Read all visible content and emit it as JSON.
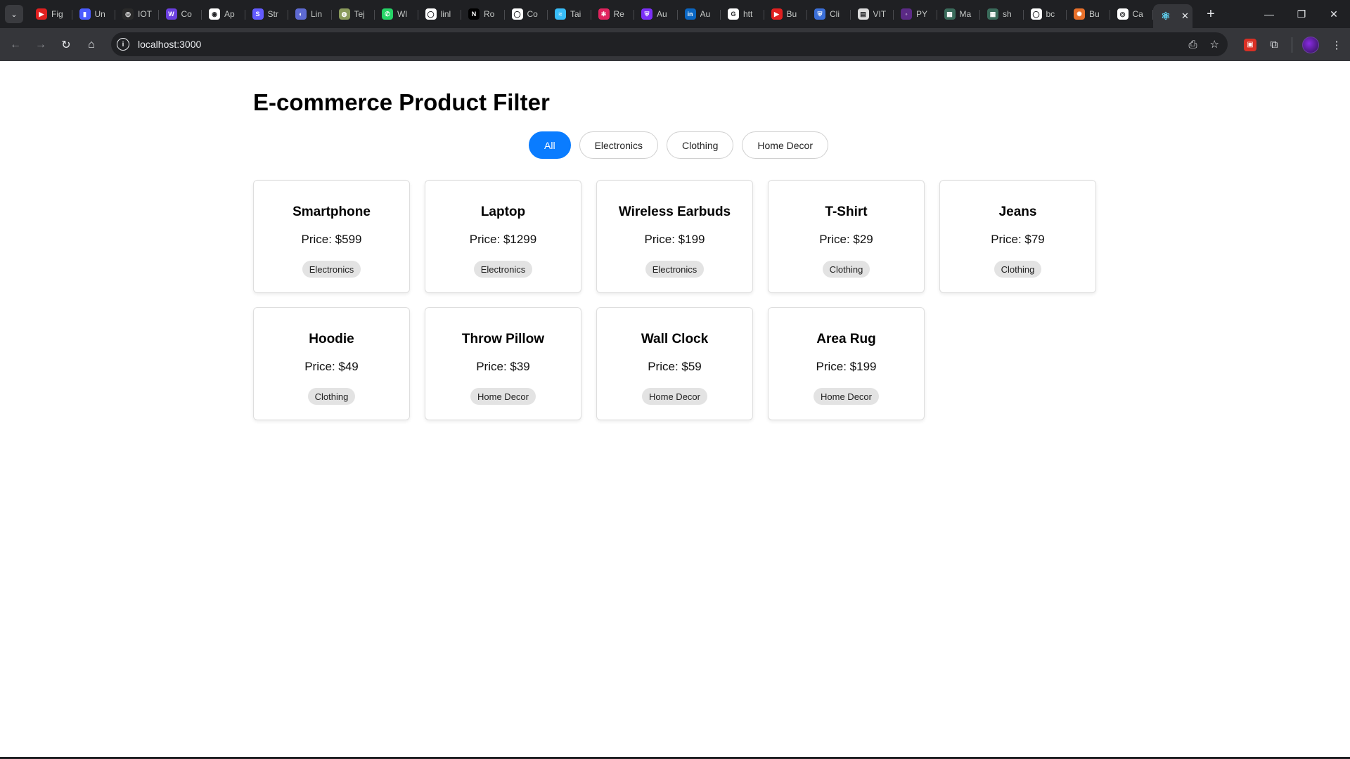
{
  "browser": {
    "tabs": [
      {
        "label": "Fig",
        "color": "#e02020",
        "glyph": "▶"
      },
      {
        "label": "Un",
        "color": "#4b5cff",
        "glyph": "▮"
      },
      {
        "label": "IOT",
        "color": "#2a2a2a",
        "glyph": "◎"
      },
      {
        "label": "Co",
        "color": "#6b3fe0",
        "glyph": "W"
      },
      {
        "label": "Ap",
        "color": "#ffffff",
        "glyph": "◉"
      },
      {
        "label": "Str",
        "color": "#635bff",
        "glyph": "S"
      },
      {
        "label": "Lin",
        "color": "#5e6ad2",
        "glyph": "◐"
      },
      {
        "label": "Tej",
        "color": "#8a9a5b",
        "glyph": "◍"
      },
      {
        "label": "Wl",
        "color": "#25d366",
        "glyph": "✆"
      },
      {
        "label": "linl",
        "color": "#ffffff",
        "glyph": "◯"
      },
      {
        "label": "Ro",
        "color": "#000000",
        "glyph": "N"
      },
      {
        "label": "Co",
        "color": "#ffffff",
        "glyph": "◯"
      },
      {
        "label": "Tai",
        "color": "#38bdf8",
        "glyph": "≈"
      },
      {
        "label": "Re",
        "color": "#e0245e",
        "glyph": "✻"
      },
      {
        "label": "Au",
        "color": "#7b2ff7",
        "glyph": "⛨"
      },
      {
        "label": "Au",
        "color": "#0a66c2",
        "glyph": "in"
      },
      {
        "label": "htt",
        "color": "#ffffff",
        "glyph": "G"
      },
      {
        "label": "Bu",
        "color": "#e02020",
        "glyph": "▶"
      },
      {
        "label": "Cli",
        "color": "#3b6fd8",
        "glyph": "⛨"
      },
      {
        "label": "VIT",
        "color": "#dddddd",
        "glyph": "▤"
      },
      {
        "label": "PY",
        "color": "#5b2a86",
        "glyph": "◦"
      },
      {
        "label": "Ma",
        "color": "#3a6b5b",
        "glyph": "▦"
      },
      {
        "label": "sh",
        "color": "#3a6b5b",
        "glyph": "▦"
      },
      {
        "label": "bc",
        "color": "#ffffff",
        "glyph": "◯"
      },
      {
        "label": "Bu",
        "color": "#e8702a",
        "glyph": "✺"
      },
      {
        "label": "Ca",
        "color": "#ffffff",
        "glyph": "◎"
      }
    ],
    "active_tab_glyph": "⚛",
    "url": "localhost:3000"
  },
  "page": {
    "title": "E-commerce Product Filter",
    "filters": [
      {
        "label": "All",
        "active": true
      },
      {
        "label": "Electronics",
        "active": false
      },
      {
        "label": "Clothing",
        "active": false
      },
      {
        "label": "Home Decor",
        "active": false
      }
    ],
    "products": [
      {
        "name": "Smartphone",
        "price": "Price: $599",
        "category": "Electronics"
      },
      {
        "name": "Laptop",
        "price": "Price: $1299",
        "category": "Electronics"
      },
      {
        "name": "Wireless Earbuds",
        "price": "Price: $199",
        "category": "Electronics"
      },
      {
        "name": "T-Shirt",
        "price": "Price: $29",
        "category": "Clothing"
      },
      {
        "name": "Jeans",
        "price": "Price: $79",
        "category": "Clothing"
      },
      {
        "name": "Hoodie",
        "price": "Price: $49",
        "category": "Clothing"
      },
      {
        "name": "Throw Pillow",
        "price": "Price: $39",
        "category": "Home Decor"
      },
      {
        "name": "Wall Clock",
        "price": "Price: $59",
        "category": "Home Decor"
      },
      {
        "name": "Area Rug",
        "price": "Price: $199",
        "category": "Home Decor"
      }
    ]
  }
}
